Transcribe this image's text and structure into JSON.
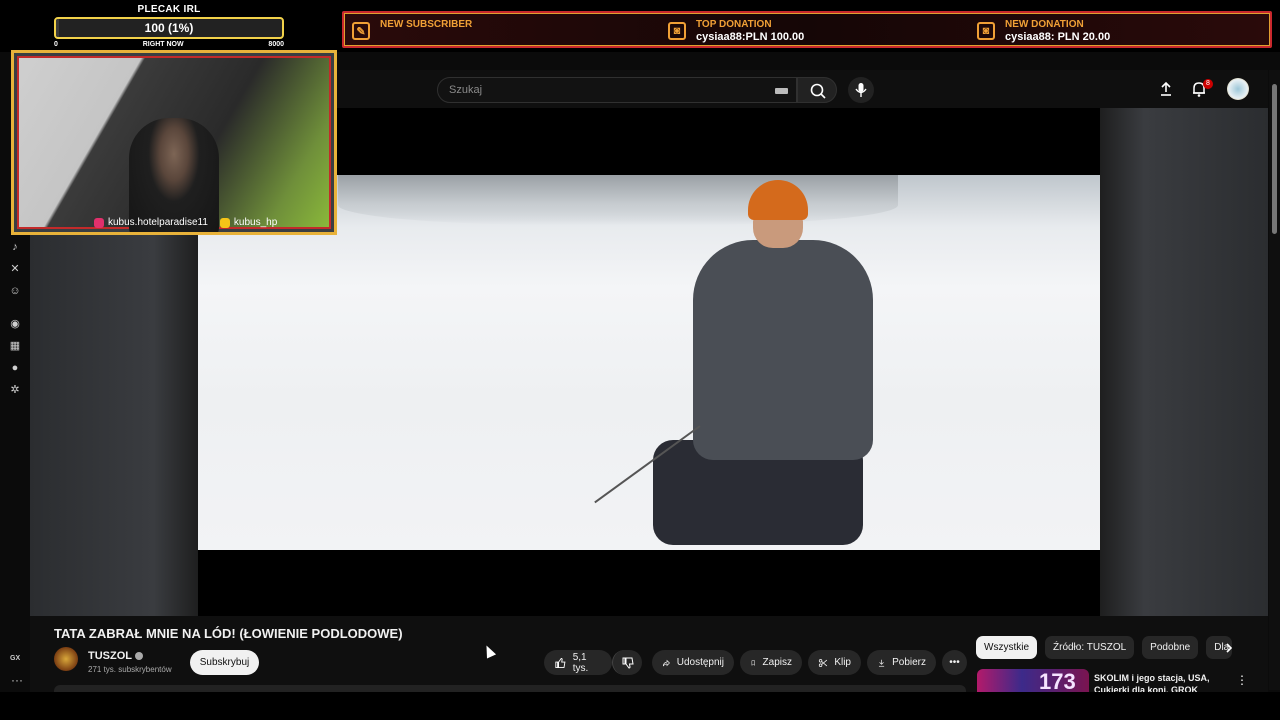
{
  "overlay": {
    "plecak": {
      "title": "PLECAK IRL",
      "value_label": "100 (1%)",
      "scale_min": "0",
      "scale_mid": "RIGHT NOW",
      "scale_max": "8000",
      "progress_fraction": 0.0125
    },
    "alerts": [
      {
        "icon": "new-subscriber-icon",
        "title": "NEW SUBSCRIBER",
        "value": ""
      },
      {
        "icon": "camera-icon",
        "title": "TOP DONATION",
        "value": "cysiaa88:PLN 100.00"
      },
      {
        "icon": "camera-icon",
        "title": "NEW DONATION",
        "value": "cysiaa88: PLN 20.00"
      }
    ],
    "socials": [
      {
        "icon": "instagram-icon",
        "label": "kubus.hotelparadise11",
        "color": "#e1306c"
      },
      {
        "icon": "youtube-icon",
        "label": "kubus_hp",
        "color": "#f5c518"
      }
    ],
    "left_rail_icons": [
      "tiktok-icon",
      "x-icon",
      "discord-icon",
      "circle-icon",
      "cards-icon",
      "bear-icon",
      "gears-icon"
    ],
    "bottom_left_label": "GX"
  },
  "header": {
    "search_placeholder": "Szukaj",
    "notification_count": "8"
  },
  "video": {
    "title": "TATA ZABRAŁ MNIE NA LÓD! (ŁOWIENIE PODLODOWE)",
    "channel": {
      "name": "TUSZOL",
      "subscribers": "271 tys. subskrybentów"
    },
    "subscribe_label": "Subskrybuj",
    "actions": {
      "likes": "5,1 tys.",
      "share": "Udostępnij",
      "save": "Zapisz",
      "clip": "Klip",
      "download": "Pobierz"
    }
  },
  "sidebar": {
    "chips": [
      "Wszystkie",
      "Źródło: TUSZOL",
      "Podobne",
      "Dla"
    ],
    "recommendation": {
      "thumb_text": "173",
      "title": "SKOLIM i jego stacja, USA, Cukierki dla koni, GROK"
    }
  },
  "colors": {
    "accent_gold": "#f0a036",
    "alert_red": "#c9282d",
    "yt_bg": "#0f0f0f"
  }
}
